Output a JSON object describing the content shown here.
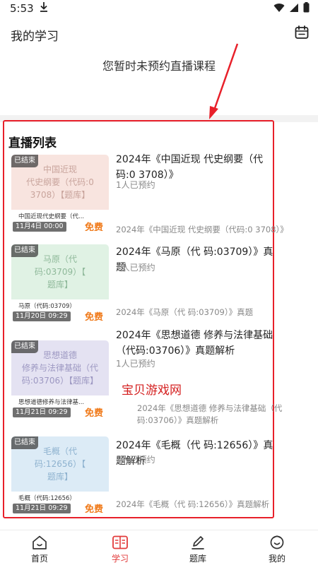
{
  "status_bar": {
    "time": "5:53"
  },
  "header": {
    "title": "我的学习"
  },
  "empty_notice": "您暂时未预约直播课程",
  "section": {
    "title": "直播列表"
  },
  "courses": [
    {
      "thumb_text": "中国近现\n代史纲要（代码:0\n3708）【题库】",
      "thumb_name": "中国近现代史纲要（代...",
      "ended_badge": "已结束",
      "date": "11月4日 00:00",
      "free_tag": "免费",
      "title": "2024年《中国近现 代史纲要（代码:0 3708）》",
      "booked": "1人已预约",
      "subtitle": "2024年《中国近现 代史纲要（代码:0 3708）》",
      "colors": {
        "art_bg": "#f8e4df",
        "art_text": "#c8a49c"
      }
    },
    {
      "thumb_text": "马原（代\n码:03709）【\n题库】",
      "thumb_name": "马原（代码:03709）",
      "ended_badge": "已结束",
      "date": "11月20日 09:29",
      "free_tag": "免费",
      "title": "2024年《马原（代 码:03709）》真题",
      "booked": "1人已预约",
      "subtitle": "2024年《马原（代 码:03709）》真题",
      "colors": {
        "art_bg": "#e0f2e4",
        "art_text": "#8fb99a"
      }
    },
    {
      "thumb_text": "思想道德\n修养与法律基础（代\n码:03706）【题库】",
      "thumb_name": "思想道德修养与法律基...",
      "ended_badge": "已结束",
      "date": "11月21日 09:29",
      "free_tag": "免费",
      "title": "2024年《思想道德 修养与法律基础（代码:03706）》真题解析",
      "booked": "1人已预约",
      "subtitle": "2024年《思想道德 修养与法律基础（代 码:03706）》真题解析",
      "colors": {
        "art_bg": "#e4e2f2",
        "art_text": "#9d98c2"
      }
    },
    {
      "thumb_text": "毛概（代\n码:12656）【\n题库】",
      "thumb_name": "毛概（代码:12656）",
      "ended_badge": "已结束",
      "date": "11月21日 09:29",
      "free_tag": "免费",
      "title": "2024年《毛概（代 码:12656）》真题解析",
      "booked": "1人已预约",
      "subtitle": "2024年《毛概（代 码:12656）》真题解析",
      "colors": {
        "art_bg": "#dcebf6",
        "art_text": "#8eb2cf"
      }
    }
  ],
  "watermark": "宝贝游戏网",
  "tabs": [
    {
      "label": "首页",
      "icon": "home-icon",
      "active": false
    },
    {
      "label": "学习",
      "icon": "book-icon",
      "active": true
    },
    {
      "label": "题库",
      "icon": "pencil-icon",
      "active": false
    },
    {
      "label": "我的",
      "icon": "profile-icon",
      "active": false
    }
  ],
  "colors": {
    "accent": "#e23b3b",
    "highlight_border": "#e8202a",
    "free": "#f07a1a"
  }
}
